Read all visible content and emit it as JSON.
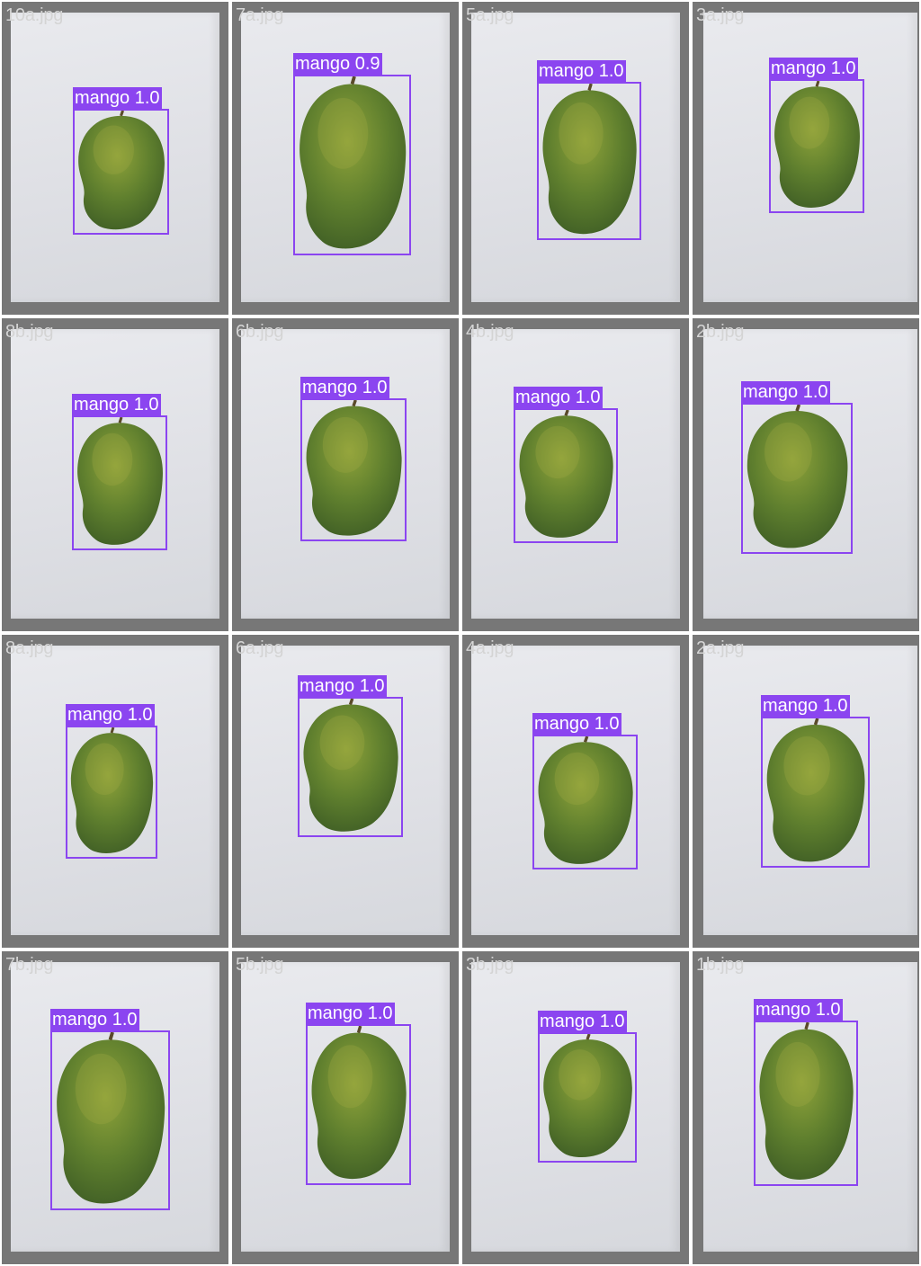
{
  "colors": {
    "frame": "#777777",
    "box": "#8b45f0",
    "label_text": "#ffffff",
    "filename_text": "#d4d4d4"
  },
  "tiles": [
    {
      "filename": "10a.jpg",
      "label": "mango",
      "confidence": "1.0"
    },
    {
      "filename": "7a.jpg",
      "label": "mango",
      "confidence": "0.9"
    },
    {
      "filename": "5a.jpg",
      "label": "mango",
      "confidence": "1.0"
    },
    {
      "filename": "3a.jpg",
      "label": "mango",
      "confidence": "1.0"
    },
    {
      "filename": "8b.jpg",
      "label": "mango",
      "confidence": "1.0"
    },
    {
      "filename": "6b.jpg",
      "label": "mango",
      "confidence": "1.0"
    },
    {
      "filename": "4b.jpg",
      "label": "mango",
      "confidence": "1.0"
    },
    {
      "filename": "2b.jpg",
      "label": "mango",
      "confidence": "1.0"
    },
    {
      "filename": "8a.jpg",
      "label": "mango",
      "confidence": "1.0"
    },
    {
      "filename": "6a.jpg",
      "label": "mango",
      "confidence": "1.0"
    },
    {
      "filename": "4a.jpg",
      "label": "mango",
      "confidence": "1.0"
    },
    {
      "filename": "2a.jpg",
      "label": "mango",
      "confidence": "1.0"
    },
    {
      "filename": "7b.jpg",
      "label": "mango",
      "confidence": "1.0"
    },
    {
      "filename": "5b.jpg",
      "label": "mango",
      "confidence": "1.0"
    },
    {
      "filename": "3b.jpg",
      "label": "mango",
      "confidence": "1.0"
    },
    {
      "filename": "1b.jpg",
      "label": "mango",
      "confidence": "1.0"
    }
  ]
}
